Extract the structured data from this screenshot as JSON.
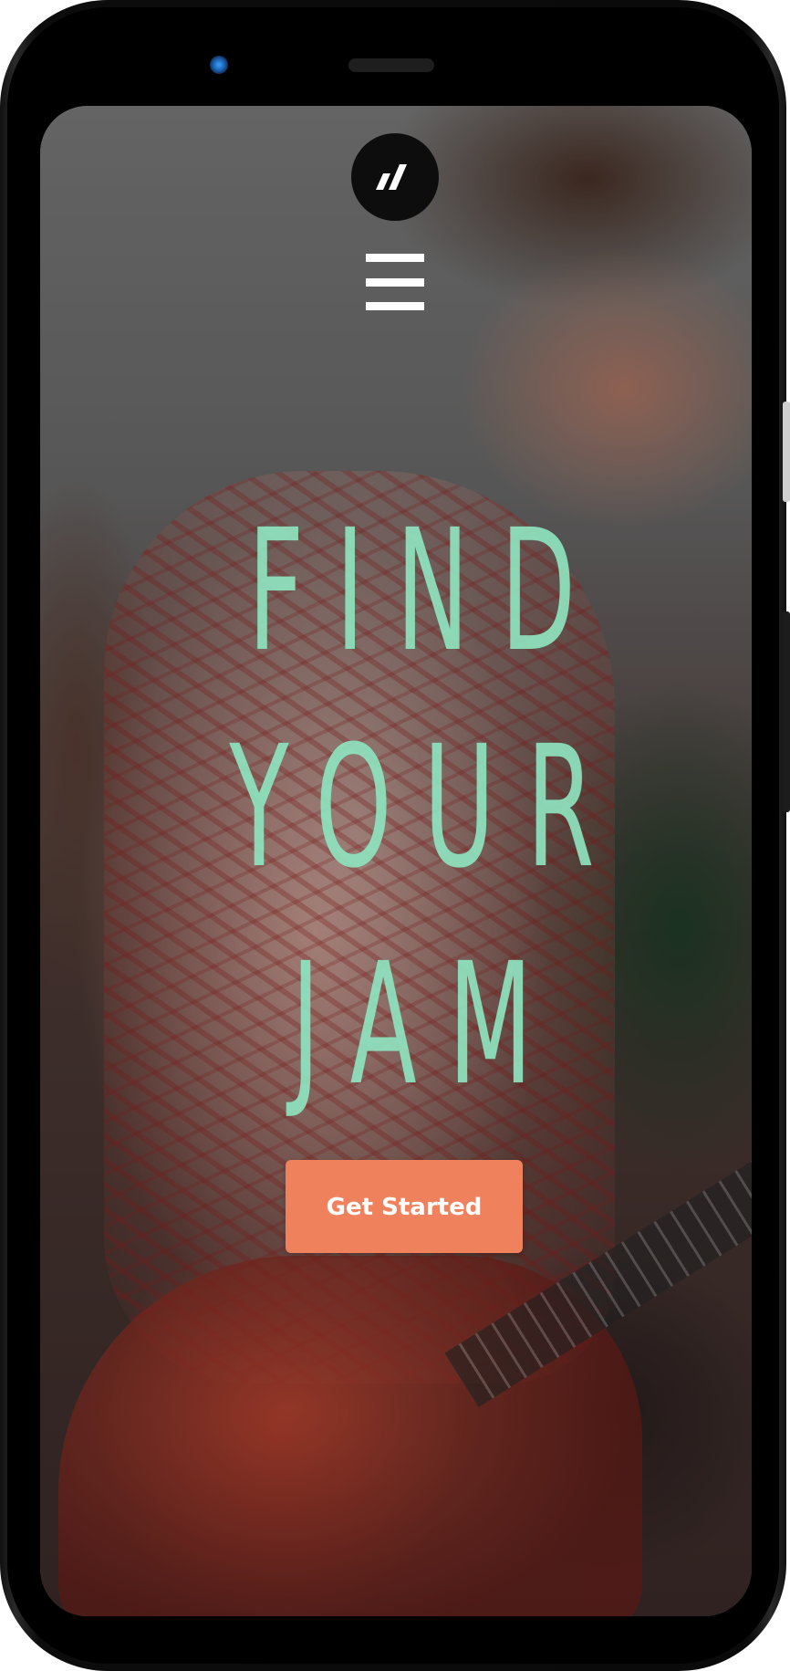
{
  "device": {
    "frame_color": "#0b0b0b",
    "camera_color": "#3aa0ff"
  },
  "header": {
    "logo_icon": "brand-slash-logo-icon",
    "menu_icon": "hamburger-menu-icon"
  },
  "hero": {
    "line1": "FIND",
    "line2": "YOUR",
    "line3": "JAM",
    "text_color": "#8fe3bf"
  },
  "cta": {
    "label": "Get Started",
    "background_color": "#f0815d"
  },
  "background": {
    "image_subject": "guitarist-photo"
  }
}
